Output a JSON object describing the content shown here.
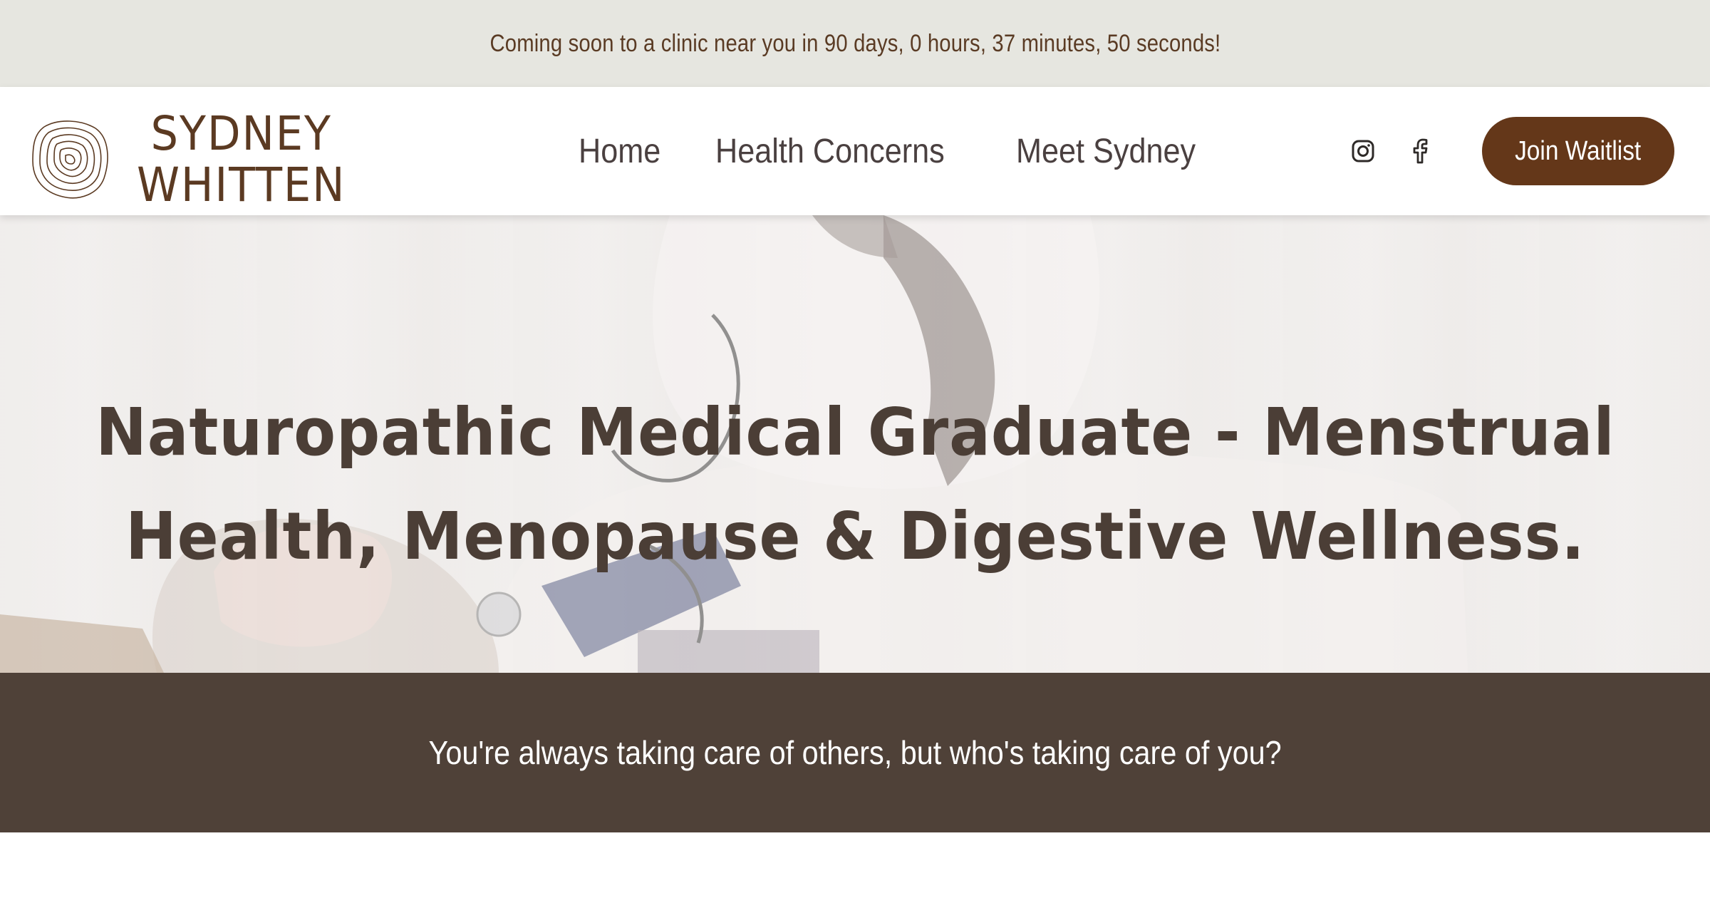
{
  "announcement": {
    "text": "Coming soon to a clinic near you in 90 days, 0 hours, 37 minutes, 50 seconds!"
  },
  "header": {
    "logo": {
      "line1": "SYDNEY",
      "line2": "WHITTEN"
    },
    "nav": [
      {
        "label": "Home"
      },
      {
        "label": "Health Concerns"
      },
      {
        "label": "Meet Sydney"
      }
    ],
    "social": [
      {
        "icon": "instagram-icon"
      },
      {
        "icon": "facebook-icon"
      }
    ],
    "cta_label": "Join Waitlist"
  },
  "hero": {
    "title_line1": "Naturopathic Medical Graduate - Menstrual",
    "title_line2": "Health, Menopause & Digestive Wellness."
  },
  "tagline": {
    "text": "You're always taking care of others, but who's taking care of you?"
  },
  "colors": {
    "announcement_bg": "#e6e6e0",
    "brand_brown": "#643719",
    "text_brown": "#5b3a22",
    "band_bg": "#4f4138"
  }
}
